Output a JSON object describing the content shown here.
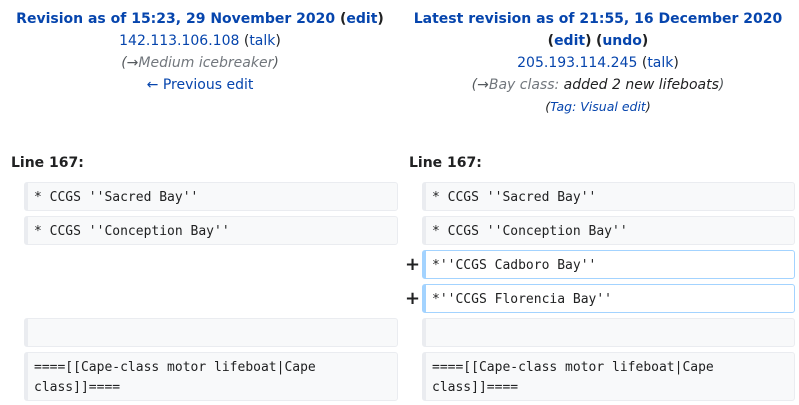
{
  "left": {
    "title": "Revision as of 15:23, 29 November 2020",
    "paren_open": " (",
    "edit_label": "edit",
    "paren_close": ")",
    "user": "142.113.106.108",
    "talk_label": "talk",
    "summary_prefix": "(→",
    "summary_section": "Medium icebreaker",
    "summary_suffix": ")",
    "prev_edit": "← Previous edit",
    "line_label": "Line 167:"
  },
  "right": {
    "title": "Latest revision as of 21:55, 16 December 2020",
    "edit_label": "edit",
    "undo_label": "undo",
    "user": "205.193.114.245",
    "talk_label": "talk",
    "summary_prefix": "(→",
    "summary_section": "Bay class:",
    "summary_text": " added 2 new lifeboats",
    "summary_suffix": ")",
    "tag_prefix": "(",
    "tag_label": "Tag: Visual edit",
    "tag_suffix": ")",
    "line_label": "Line 167:"
  },
  "diff": {
    "marker": "+",
    "ctx1": "* CCGS ''Sacred Bay''",
    "ctx2": "* CCGS ''Conception Bay''",
    "add1": "*''CCGS Cadboro Bay''",
    "add2": "*''CCGS Florencia Bay''",
    "empty": "",
    "ctx3": "====[[Cape-class motor lifeboat|Cape class]]===="
  },
  "colors": {
    "link": "#0645ad",
    "added_border": "#a3d3ff",
    "context_bg": "#f8f9fa"
  }
}
